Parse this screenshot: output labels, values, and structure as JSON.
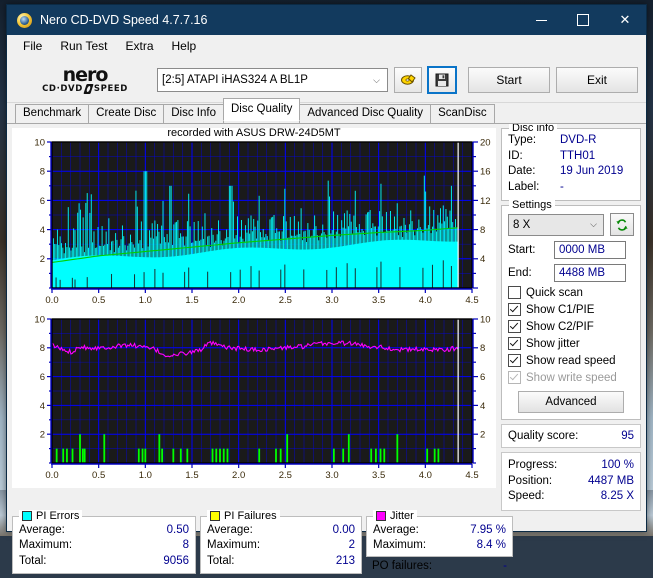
{
  "window": {
    "title": "Nero CD-DVD Speed 4.7.7.16",
    "icon": "nero-disc-icon",
    "minimize": "–",
    "maximize": "□",
    "close": "✕"
  },
  "menu": {
    "items": [
      {
        "label": "File"
      },
      {
        "label": "Run Test"
      },
      {
        "label": "Extra"
      },
      {
        "label": "Help"
      }
    ]
  },
  "toolbar": {
    "logo_word": "nero",
    "logo_sub_left": "CD·DVD",
    "logo_sub_right": "SPEED",
    "drive_value": "[2:5]   ATAPI iHAS324   A BL1P",
    "drive_caret": "⌵",
    "eject_icon": "disc-eject-icon",
    "save_icon": "floppy-save-icon",
    "start_label": "Start",
    "exit_label": "Exit"
  },
  "tabs": [
    {
      "label": "Benchmark",
      "active": false
    },
    {
      "label": "Create Disc",
      "active": false
    },
    {
      "label": "Disc Info",
      "active": false
    },
    {
      "label": "Disc Quality",
      "active": true
    },
    {
      "label": "Advanced Disc Quality",
      "active": false
    },
    {
      "label": "ScanDisc",
      "active": false
    }
  ],
  "chart_header": "recorded with ASUS      DRW-24D5MT",
  "disc_info": {
    "title": "Disc info",
    "rows": [
      {
        "key": "Type:",
        "value": "DVD-R"
      },
      {
        "key": "ID:",
        "value": "TTH01"
      },
      {
        "key": "Date:",
        "value": "19 Jun 2019"
      },
      {
        "key": "Label:",
        "value": "-"
      }
    ]
  },
  "settings": {
    "title": "Settings",
    "speed_value": "8 X",
    "speed_caret": "⌵",
    "refresh_icon": "refresh-icon",
    "start_label": "Start:",
    "start_value": "0000 MB",
    "end_label": "End:",
    "end_value": "4488 MB",
    "checkboxes": [
      {
        "label": "Quick scan",
        "checked": false,
        "disabled": false
      },
      {
        "label": "Show C1/PIE",
        "checked": true,
        "disabled": false
      },
      {
        "label": "Show C2/PIF",
        "checked": true,
        "disabled": false
      },
      {
        "label": "Show jitter",
        "checked": true,
        "disabled": false
      },
      {
        "label": "Show read speed",
        "checked": true,
        "disabled": false
      },
      {
        "label": "Show write speed",
        "checked": true,
        "disabled": true
      }
    ],
    "advanced_label": "Advanced"
  },
  "quality": {
    "label": "Quality score:",
    "value": "95"
  },
  "progress": {
    "rows": [
      {
        "key": "Progress:",
        "value": "100 %"
      },
      {
        "key": "Position:",
        "value": "4487 MB"
      },
      {
        "key": "Speed:",
        "value": "8.25 X"
      }
    ]
  },
  "stats": {
    "pi_errors": {
      "title": "PI Errors",
      "color": "#00ffff",
      "rows": [
        {
          "key": "Average:",
          "value": "0.50"
        },
        {
          "key": "Maximum:",
          "value": "8"
        },
        {
          "key": "Total:",
          "value": "9056"
        }
      ]
    },
    "pi_failures": {
      "title": "PI Failures",
      "color": "#ffff00",
      "rows": [
        {
          "key": "Average:",
          "value": "0.00"
        },
        {
          "key": "Maximum:",
          "value": "2"
        },
        {
          "key": "Total:",
          "value": "213"
        }
      ]
    },
    "jitter": {
      "title": "Jitter",
      "color": "#ff00ff",
      "rows": [
        {
          "key": "Average:",
          "value": "7.95 %"
        },
        {
          "key": "Maximum:",
          "value": "8.4 %"
        }
      ],
      "po_key": "PO failures:",
      "po_value": "-"
    }
  },
  "chart_data": [
    {
      "type": "bar",
      "name": "pi-errors-chart",
      "title": "recorded with ASUS      DRW-24D5MT",
      "xlabel": "",
      "ylabel": "",
      "xlim": [
        0,
        4.5
      ],
      "xticks": [
        "0.0",
        "0.5",
        "1.0",
        "1.5",
        "2.0",
        "2.5",
        "3.0",
        "3.5",
        "4.0",
        "4.5"
      ],
      "ylim": [
        0,
        10
      ],
      "yticks": [
        "2",
        "4",
        "6",
        "8",
        "10"
      ],
      "y2lim": [
        0,
        20
      ],
      "y2ticks": [
        "4",
        "8",
        "12",
        "16",
        "20"
      ],
      "grid": true,
      "plot_bg": "#1a1a1a",
      "grid_color": "#0000ff",
      "bar_color": "#00ffff",
      "series": [
        {
          "name": "PI Errors",
          "color": "#00ffff",
          "kind": "bars",
          "note": "dense cyan spikes, baseline ~2-3 rising to ~4 at disc end; peaks 5-8",
          "x": [
            0.0,
            0.05,
            0.1,
            0.15,
            0.2,
            0.25,
            0.3,
            0.35,
            0.4,
            0.45,
            0.5,
            0.55,
            0.6,
            0.65,
            0.7,
            0.75,
            0.8,
            0.85,
            0.9,
            0.95,
            1.0,
            1.05,
            1.1,
            1.15,
            1.2,
            1.25,
            1.3,
            1.35,
            1.4,
            1.45,
            1.5,
            1.55,
            1.6,
            1.65,
            1.7,
            1.75,
            1.8,
            1.85,
            1.9,
            1.95,
            2.0,
            2.05,
            2.1,
            2.15,
            2.2,
            2.25,
            2.3,
            2.35,
            2.4,
            2.45,
            2.5,
            2.55,
            2.6,
            2.65,
            2.7,
            2.75,
            2.8,
            2.85,
            2.9,
            2.95,
            3.0,
            3.05,
            3.1,
            3.15,
            3.2,
            3.25,
            3.3,
            3.35,
            3.4,
            3.45,
            3.5,
            3.55,
            3.6,
            3.65,
            3.7,
            3.75,
            3.8,
            3.85,
            3.9,
            3.95,
            4.0,
            4.05,
            4.1,
            4.15,
            4.2,
            4.25,
            4.3,
            4.35
          ],
          "values": [
            3,
            5,
            4,
            3,
            4,
            5,
            5,
            3,
            5,
            4,
            5,
            6,
            6,
            4,
            5,
            4,
            5,
            6,
            5,
            4,
            8,
            4,
            5,
            5,
            6,
            7,
            5,
            4,
            3,
            5,
            4,
            3,
            5,
            4,
            6,
            5,
            4,
            5,
            7,
            4,
            6,
            5,
            4,
            6,
            5,
            6,
            4,
            5,
            4,
            6,
            5,
            4,
            5,
            4,
            6,
            5,
            4,
            6,
            5,
            6,
            5,
            4,
            6,
            5,
            4,
            6,
            5,
            6,
            5,
            4,
            6,
            5,
            4,
            5,
            6,
            5,
            4,
            6,
            5,
            6,
            5,
            6,
            4,
            5,
            6,
            5,
            4,
            5
          ]
        },
        {
          "name": "Read speed",
          "color": "#00d000",
          "kind": "line",
          "axis": "y2",
          "note": "smooth rising CAV curve from ~3.5X to ~8.3X",
          "x": [
            0.0,
            0.5,
            1.0,
            1.5,
            2.0,
            2.5,
            3.0,
            3.5,
            4.0,
            4.35
          ],
          "values": [
            3.5,
            4.4,
            5.0,
            5.6,
            6.2,
            6.7,
            7.2,
            7.6,
            7.9,
            8.25
          ]
        }
      ]
    },
    {
      "type": "line",
      "name": "jitter-pif-chart",
      "title": "",
      "xlabel": "",
      "ylabel": "",
      "xlim": [
        0,
        4.5
      ],
      "xticks": [
        "0.0",
        "0.5",
        "1.0",
        "1.5",
        "2.0",
        "2.5",
        "3.0",
        "3.5",
        "4.0",
        "4.5"
      ],
      "ylim": [
        0,
        10
      ],
      "yticks": [
        "2",
        "4",
        "6",
        "8",
        "10"
      ],
      "grid": true,
      "plot_bg": "#1a1a1a",
      "grid_color": "#0000ff",
      "series": [
        {
          "name": "Jitter",
          "color": "#ff00ff",
          "kind": "line",
          "note": "noisy trace hovering near 8%, dips to ~7.4 near 1.3, peaks ~8.4 near 1.75 and 3.2",
          "x": [
            0.0,
            0.1,
            0.2,
            0.3,
            0.4,
            0.5,
            0.6,
            0.7,
            0.8,
            0.9,
            1.0,
            1.1,
            1.2,
            1.3,
            1.4,
            1.5,
            1.6,
            1.7,
            1.8,
            1.9,
            2.0,
            2.1,
            2.2,
            2.3,
            2.4,
            2.5,
            2.6,
            2.7,
            2.8,
            2.9,
            3.0,
            3.1,
            3.2,
            3.3,
            3.4,
            3.5,
            3.6,
            3.7,
            3.8,
            3.9,
            4.0,
            4.1,
            4.2,
            4.35
          ],
          "values": [
            8.2,
            7.9,
            7.7,
            8.1,
            8.0,
            8.0,
            8.05,
            8.1,
            8.2,
            8.15,
            8.0,
            7.9,
            7.5,
            7.45,
            7.6,
            7.7,
            7.9,
            8.35,
            8.1,
            8.0,
            7.95,
            7.9,
            7.85,
            7.9,
            7.95,
            8.0,
            8.05,
            8.1,
            8.2,
            8.3,
            8.3,
            8.35,
            8.3,
            8.2,
            8.1,
            8.1,
            7.95,
            7.9,
            7.85,
            7.9,
            7.85,
            7.9,
            7.9,
            7.95
          ]
        },
        {
          "name": "PI Failures",
          "color": "#00ff00",
          "kind": "bars",
          "note": "sparse short green spikes mostly height 1, a few reaching 2",
          "x": [
            0.05,
            0.12,
            0.16,
            0.22,
            0.3,
            0.33,
            0.35,
            0.56,
            0.93,
            0.97,
            1.0,
            1.15,
            1.18,
            1.3,
            1.38,
            1.45,
            1.72,
            1.76,
            1.8,
            1.84,
            1.88,
            2.22,
            2.4,
            2.45,
            2.52,
            3.02,
            3.12,
            3.18,
            3.42,
            3.47,
            3.52,
            3.56,
            3.7,
            4.02,
            4.1,
            4.14
          ],
          "values": [
            1,
            1,
            1,
            1,
            2,
            1,
            1,
            2,
            1,
            1,
            1,
            2,
            1,
            1,
            1,
            1,
            1,
            1,
            1,
            1,
            1,
            1,
            1,
            1,
            2,
            1,
            1,
            2,
            1,
            1,
            1,
            1,
            2,
            1,
            1,
            1
          ]
        }
      ]
    }
  ]
}
